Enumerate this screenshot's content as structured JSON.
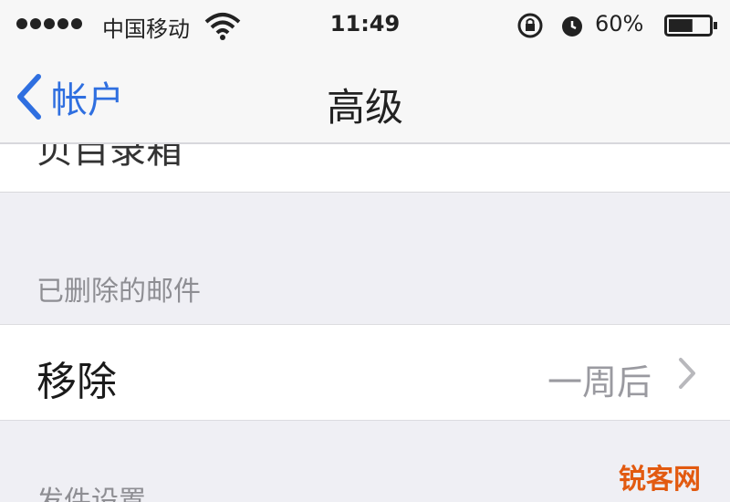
{
  "status_bar": {
    "carrier": "中国移动",
    "time": "11:49",
    "battery_percent": "60%",
    "battery_level": 0.6
  },
  "nav": {
    "back_label": "帐户",
    "title": "高级"
  },
  "cells": {
    "top_partial_label": "贝目录箱",
    "deleted_section_header": "已删除的邮件",
    "remove_label": "移除",
    "remove_value": "一周后",
    "next_section_header": "发件设置"
  },
  "watermark": "锐客网"
}
